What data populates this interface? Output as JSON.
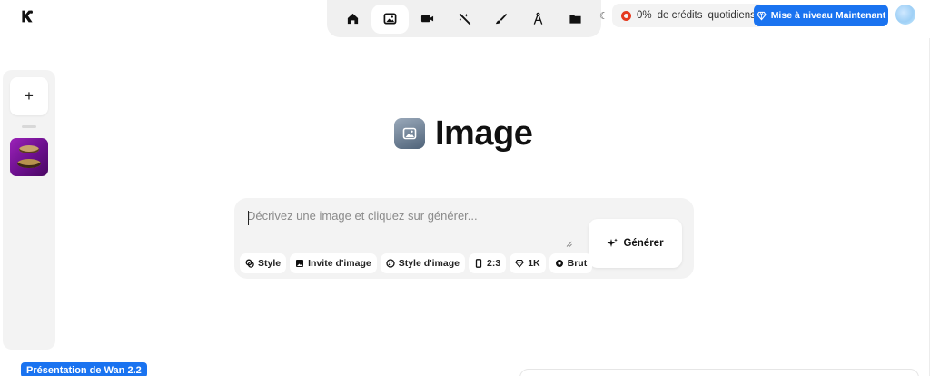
{
  "nav": {
    "items": [
      {
        "name": "home",
        "icon": "home-icon"
      },
      {
        "name": "image",
        "icon": "image-icon",
        "active": true
      },
      {
        "name": "video",
        "icon": "video-icon"
      },
      {
        "name": "edit",
        "icon": "magic-wand-icon"
      },
      {
        "name": "draw",
        "icon": "brush-icon"
      },
      {
        "name": "design",
        "icon": "compass-icon"
      },
      {
        "name": "assets",
        "icon": "folder-icon"
      }
    ]
  },
  "credits": {
    "percent": "0%",
    "label": "de crédits",
    "suffix": "quotidiens"
  },
  "upgrade": {
    "label": "Mise à niveau Maintenant"
  },
  "sidebar": {
    "add_label": "+"
  },
  "hero": {
    "title": "Image"
  },
  "prompt": {
    "placeholder": "Décrivez une image et cliquez sur générer...",
    "value": ""
  },
  "generate": {
    "label": "Générer"
  },
  "chips": [
    {
      "label": "Style",
      "icon": "style-icon"
    },
    {
      "label": "Invite d'image",
      "icon": "image-prompt-icon"
    },
    {
      "label": "Style d'image",
      "icon": "palette-icon"
    },
    {
      "label": "2:3",
      "icon": "aspect-ratio-icon"
    },
    {
      "label": "1K",
      "icon": "diamond-icon"
    },
    {
      "label": "Brut",
      "icon": "aperture-icon"
    }
  ],
  "badge": {
    "label": "Présentation de Wan 2.2"
  },
  "colors": {
    "accent": "#1a73f0",
    "credit_ring": "#e5391f",
    "panel": "#f3f3f3"
  }
}
